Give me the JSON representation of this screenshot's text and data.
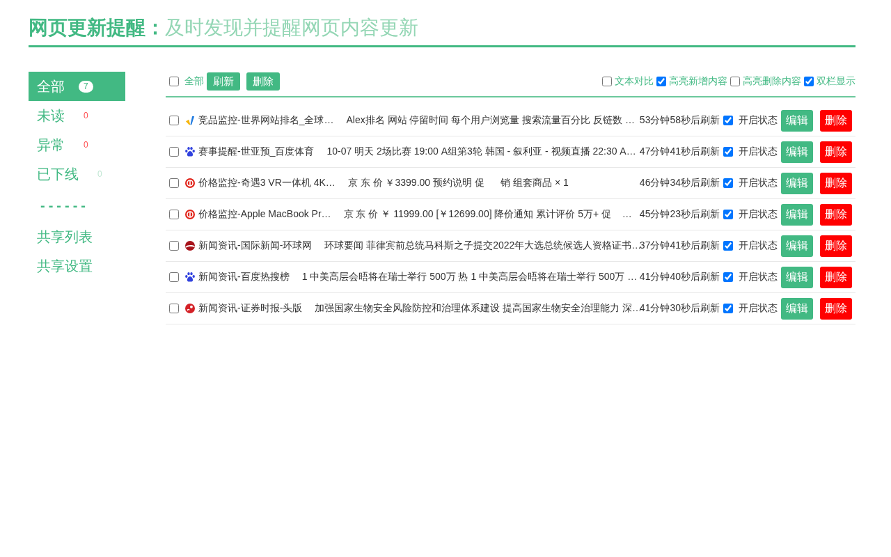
{
  "header": {
    "title": "网页更新提醒：",
    "subtitle": "及时发现并提醒网页内容更新"
  },
  "sidebar": [
    {
      "kind": "filter",
      "label": "全部",
      "count": "7",
      "selected": true,
      "color": "#42b983"
    },
    {
      "kind": "filter",
      "label": "未读",
      "count": "0",
      "selected": false,
      "color": "#ff4d4f"
    },
    {
      "kind": "filter",
      "label": "异常",
      "count": "0",
      "selected": false,
      "color": "#ff4d4f"
    },
    {
      "kind": "filter",
      "label": "已下线",
      "count": "0",
      "selected": false,
      "color": "#bfe6d2"
    },
    {
      "kind": "separator",
      "label": "------"
    },
    {
      "kind": "link",
      "label": "共享列表",
      "selected": false
    },
    {
      "kind": "link",
      "label": "共享设置",
      "selected": false
    }
  ],
  "toolbar": {
    "select_all": {
      "label": "全部",
      "checked": false
    },
    "buttons": [
      "刷新",
      "删除"
    ],
    "options": [
      {
        "label": "文本对比",
        "checked": false
      },
      {
        "label": "高亮新增内容",
        "checked": true
      },
      {
        "label": "高亮删除内容",
        "checked": false
      },
      {
        "label": "双栏显示",
        "checked": true
      }
    ]
  },
  "rows": [
    {
      "selected": false,
      "icon": {
        "kind": "bolt"
      },
      "title": "竞品监控-世界网站排名_全球…",
      "content": "Alex排名 网站 停留时间 每个用户浏览量 搜索流量百分比 反链数 …",
      "timer": "53分钟58秒后刷新",
      "enabled": true,
      "status_label": "开启状态",
      "edit_label": "编辑",
      "delete_label": "删除"
    },
    {
      "selected": false,
      "icon": {
        "kind": "paw"
      },
      "title": "赛事提醒-世亚预_百度体育",
      "content": "10-07 明天 2场比赛 19:00 A组第3轮 韩国 - 叙利亚 - 视频直播 22:30 A…",
      "timer": "47分钟41秒后刷新",
      "enabled": true,
      "status_label": "开启状态",
      "edit_label": "编辑",
      "delete_label": "删除"
    },
    {
      "selected": false,
      "icon": {
        "kind": "ring"
      },
      "title": "价格监控-奇遇3 VR一体机 4K…",
      "content": "京 东 价 ￥3399.00 预约说明 促      销 组套商品 × 1",
      "timer": "46分钟34秒后刷新",
      "enabled": true,
      "status_label": "开启状态",
      "edit_label": "编辑",
      "delete_label": "删除"
    },
    {
      "selected": false,
      "icon": {
        "kind": "ring"
      },
      "title": "价格监控-Apple MacBook Pr…",
      "content": "京 东 价 ￥ 11999.00 [￥12699.00] 降价通知 累计评价 5万+ 促    …",
      "timer": "45分钟23秒后刷新",
      "enabled": true,
      "status_label": "开启状态",
      "edit_label": "编辑",
      "delete_label": "删除"
    },
    {
      "selected": false,
      "icon": {
        "kind": "swoosh"
      },
      "title": "新闻资讯-国际新闻-环球网",
      "content": "环球要闻 菲律宾前总统马科斯之子提交2022年大选总统候选人资格证书…",
      "timer": "37分钟41秒后刷新",
      "enabled": true,
      "status_label": "开启状态",
      "edit_label": "编辑",
      "delete_label": "删除"
    },
    {
      "selected": false,
      "icon": {
        "kind": "paw"
      },
      "title": "新闻资讯-百度热搜榜",
      "content": "1 中美高层会晤将在瑞士举行 500万 热 1 中美高层会晤将在瑞士举行 500万 …",
      "timer": "41分钟40秒后刷新",
      "enabled": true,
      "status_label": "开启状态",
      "edit_label": "编辑",
      "delete_label": "删除"
    },
    {
      "selected": false,
      "icon": {
        "kind": "emblem"
      },
      "title": "新闻资讯-证券时报-头版",
      "content": "加强国家生物安全风险防控和治理体系建设 提高国家生物安全治理能力 深…",
      "timer": "41分钟30秒后刷新",
      "enabled": true,
      "status_label": "开启状态",
      "edit_label": "编辑",
      "delete_label": "删除"
    }
  ]
}
